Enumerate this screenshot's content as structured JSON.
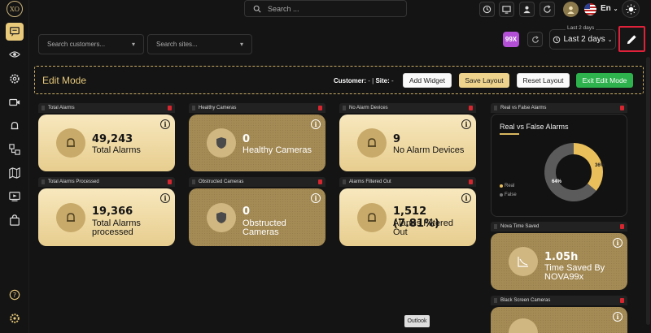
{
  "logo": "XO",
  "search": {
    "placeholder": "Search ..."
  },
  "language": "En",
  "filters": {
    "customers_placeholder": "Search customers...",
    "sites_placeholder": "Search sites..."
  },
  "badge": "99X",
  "range": {
    "legend": "Last 2 days",
    "value": "Last 2 days"
  },
  "edit_bar": {
    "title": "Edit Mode",
    "customer_label": "Customer:",
    "customer_value": "-",
    "site_label": "Site:",
    "site_value": "-",
    "add_widget": "Add Widget",
    "save_layout": "Save Layout",
    "reset_layout": "Reset Layout",
    "exit_edit": "Exit Edit Mode"
  },
  "widgets": [
    {
      "header": "Total Alarms",
      "value": "49,243",
      "label": "Total Alarms",
      "style": "light",
      "icon": "bell-icon"
    },
    {
      "header": "Healthy Cameras",
      "value": "0",
      "label": "Healthy Cameras",
      "style": "dark",
      "icon": "shield-icon"
    },
    {
      "header": "No Alarm Devices",
      "value": "9",
      "label": "No Alarm Devices",
      "style": "light",
      "icon": "bell-icon"
    },
    {
      "header": "Total Alarms Processed",
      "value": "19,366",
      "label1": "Total Alarms",
      "label2": "processed",
      "style": "light",
      "icon": "bell-icon"
    },
    {
      "header": "Obstructed Cameras",
      "value": "0",
      "label1": "Obstructed",
      "label2": "Cameras",
      "style": "dark",
      "icon": "shield-icon"
    },
    {
      "header": "Alarms Filtered Out",
      "value": "1,512 (7.81%)",
      "label1": "Alarms Filtered",
      "label2": "Out",
      "style": "light",
      "icon": "bell-icon"
    }
  ],
  "donut_widget": {
    "header": "Real vs False Alarms",
    "title": "Real vs False Alarms",
    "legend": [
      "Real",
      "False"
    ],
    "colors": {
      "real": "#e9bf5c",
      "false": "#5b5b5b"
    }
  },
  "chart_data": {
    "type": "pie",
    "categories": [
      "Real",
      "False"
    ],
    "values": [
      36,
      64
    ],
    "value_labels": [
      "36%",
      "64%"
    ],
    "title": "Real vs False Alarms"
  },
  "nova_widget": {
    "header": "Nova Time Saved",
    "value": "1.05h",
    "label1": "Time Saved By",
    "label2": "NOVA99x"
  },
  "black_widget": {
    "header": "Black Screen Cameras"
  },
  "tooltip": "Outlook",
  "colors": {
    "accent": "#e9c97a",
    "green": "#2db24d",
    "alert": "#e0213a",
    "purple": "#b24fd6"
  }
}
